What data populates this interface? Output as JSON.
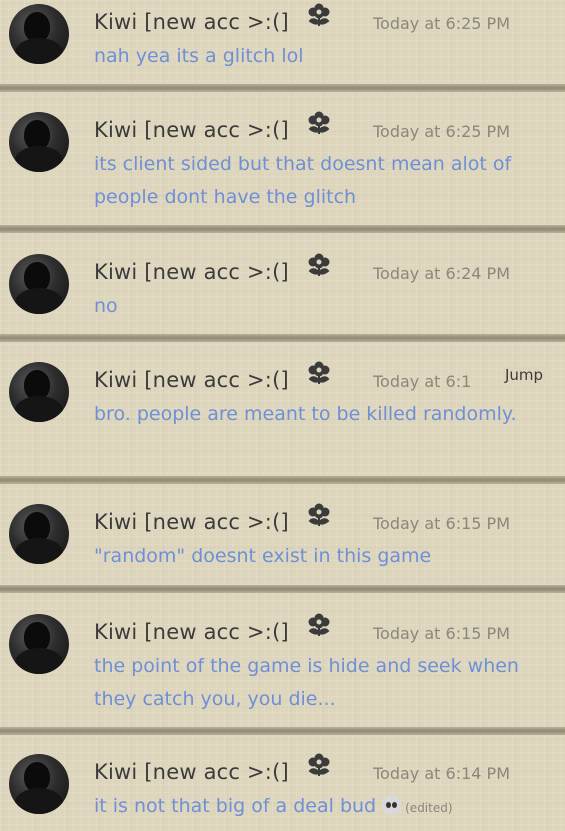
{
  "messages": [
    {
      "author": "Kiwi  [new acc >:(]",
      "timestamp": "Today at 6:25 PM",
      "text": "nah yea its a glitch lol",
      "edited": ""
    },
    {
      "author": "Kiwi  [new acc >:(]",
      "timestamp": "Today at 6:25 PM",
      "text": "its client sided but that doesnt mean alot of people dont have the glitch",
      "edited": ""
    },
    {
      "author": "Kiwi  [new acc >:(]",
      "timestamp": "Today at 6:24 PM",
      "text": "no",
      "edited": ""
    },
    {
      "author": "Kiwi  [new acc >:(]",
      "timestamp": "Today at 6:1",
      "text": "bro. people are meant to be killed randomly.",
      "edited": ""
    },
    {
      "author": "Kiwi  [new acc >:(]",
      "timestamp": "Today at 6:15 PM",
      "text": "\"random\" doesnt exist in this game",
      "edited": ""
    },
    {
      "author": "Kiwi  [new acc >:(]",
      "timestamp": "Today at 6:15 PM",
      "text": "the point of the game is hide and seek when they catch you, you die...",
      "edited": ""
    },
    {
      "author": "Kiwi  [new acc >:(]",
      "timestamp": "Today at 6:14 PM",
      "text": "it is not that big of a deal bud",
      "edited": "(edited)"
    }
  ],
  "jump_label": "Jump",
  "colors": {
    "message_text": "#6f8fd6",
    "author": "#3b3b3b",
    "timestamp": "#8a877c",
    "background": "#ddd6bd"
  },
  "icons": {
    "author_badge": "flower-badge-icon",
    "emoji": "skull-emoji-icon"
  }
}
